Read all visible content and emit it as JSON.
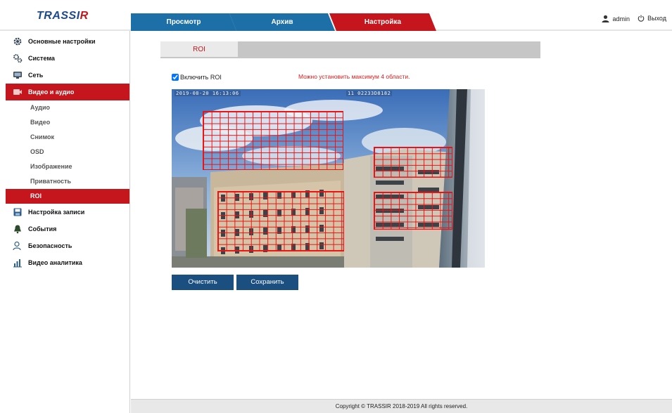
{
  "header": {
    "logo_main": "TRASSI",
    "logo_accent": "R",
    "tabs": [
      {
        "label": "Просмотр"
      },
      {
        "label": "Архив"
      },
      {
        "label": "Настройка"
      }
    ],
    "user": "admin",
    "logout": "Выход"
  },
  "sidebar": {
    "items": [
      {
        "label": "Основные настройки",
        "icon": "gear-icon"
      },
      {
        "label": "Система",
        "icon": "gears-icon"
      },
      {
        "label": "Сеть",
        "icon": "network-icon"
      },
      {
        "label": "Видео и аудио",
        "icon": "video-icon"
      },
      {
        "label": "Настройка записи",
        "icon": "record-icon"
      },
      {
        "label": "События",
        "icon": "bell-icon"
      },
      {
        "label": "Безопасность",
        "icon": "user-security-icon"
      },
      {
        "label": "Видео аналитика",
        "icon": "analytics-icon"
      }
    ],
    "subitems": [
      {
        "label": "Аудио"
      },
      {
        "label": "Видео"
      },
      {
        "label": "Снимок"
      },
      {
        "label": "OSD"
      },
      {
        "label": "Изображение"
      },
      {
        "label": "Приватность"
      },
      {
        "label": "ROI"
      }
    ]
  },
  "main": {
    "tab_label": "ROI",
    "enable_label": "Включить ROI",
    "enable_checked": true,
    "warning": "Можно установить максимум 4 области.",
    "osd_date": "2019-08-20 16:13:06",
    "osd_channel": "11 02233D8182",
    "clear_button": "Очистить",
    "save_button": "Сохранить"
  },
  "footer": {
    "copyright": "Copyright © TRASSIR 2018-2019 All rights reserved."
  },
  "colors": {
    "brand_red": "#c4161c",
    "tab_blue": "#1d6fa8",
    "button_blue": "#1a4f80"
  }
}
